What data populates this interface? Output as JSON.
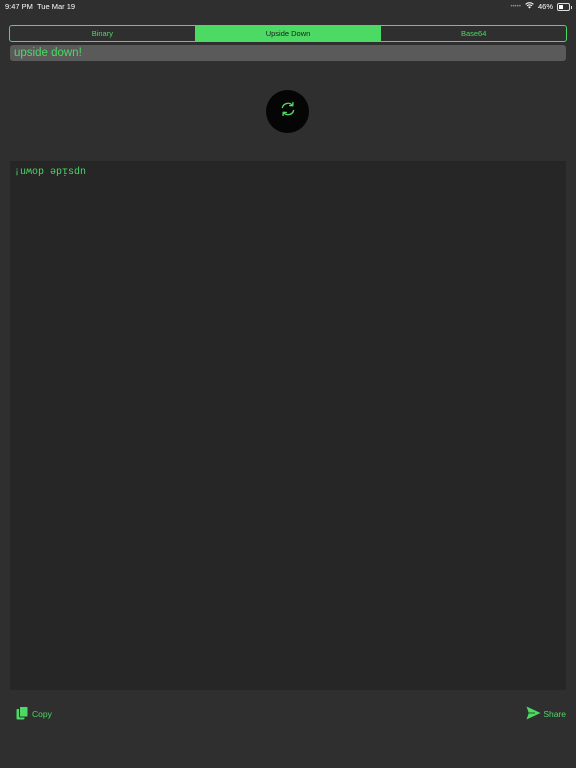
{
  "status_bar": {
    "time": "9:47 PM",
    "date": "Tue Mar 19",
    "battery_text": "46%",
    "battery_level": 0.46
  },
  "segments": [
    {
      "label": "Binary",
      "selected": false
    },
    {
      "label": "Upside Down",
      "selected": true
    },
    {
      "label": "Base64",
      "selected": false
    }
  ],
  "input": {
    "value": "upside down!"
  },
  "output": {
    "text": "¡uʍop ǝpᴉsdn"
  },
  "footer": {
    "copy_label": "Copy",
    "share_label": "Share"
  },
  "colors": {
    "accent": "#4cd964",
    "background": "#2f2f2f",
    "output_background": "#262626",
    "input_background": "#5a5a5a"
  },
  "icons": {
    "convert": "refresh-icon",
    "copy": "copy-icon",
    "share": "send-icon",
    "wifi": "wifi-icon",
    "battery": "battery-icon"
  }
}
